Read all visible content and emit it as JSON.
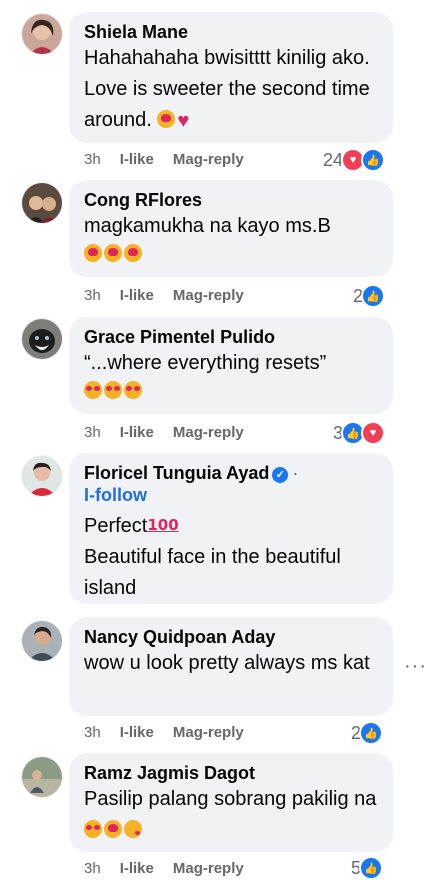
{
  "common": {
    "time": "3h",
    "like": "I-like",
    "reply": "Mag-reply"
  },
  "comments": [
    {
      "name": "Shiela Mane",
      "text": "Hahahahaha bwisitttt kinilig ako. Love is sweeter the second time around.",
      "reaction_count": "24"
    },
    {
      "name": "Cong RFlores",
      "text": "magkamukha na kayo ms.B",
      "reaction_count": "2"
    },
    {
      "name": "Grace Pimentel Pulido",
      "text": "“...where everything resets”",
      "reaction_count": "3"
    },
    {
      "name": "Floricel Tunguia Ayad",
      "follow": "I-follow",
      "text1": "Perfect",
      "text2": "Beautiful face in the beautiful island"
    },
    {
      "name": "Nancy Quidpoan Aday",
      "text": "wow u look pretty always ms kat",
      "reaction_count": "2"
    },
    {
      "name": "Ramz Jagmis Dagot",
      "text": "Pasilip palang sobrang pakilig na",
      "reaction_count": "5"
    }
  ],
  "colors": {
    "bubble": "#f0f2f5",
    "link": "#216fdb",
    "like": "#1877f2",
    "love": "#f33e58",
    "meta": "#65676b"
  },
  "icons": [
    "like-reaction-icon",
    "love-reaction-icon",
    "verified-badge-icon",
    "more-options-icon"
  ]
}
